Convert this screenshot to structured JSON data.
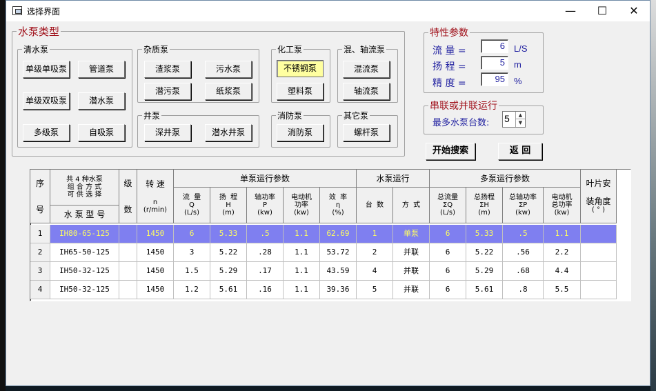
{
  "window": {
    "title": "选择界面",
    "minimize": "—",
    "maximize": "☐",
    "close": "✕"
  },
  "pump_types": {
    "legend": "水泵类型",
    "groups": {
      "clean": {
        "legend": "清水泵",
        "buttons": [
          "单级单吸泵",
          "管道泵",
          "单级双吸泵",
          "潜水泵",
          "多级泵",
          "自吸泵"
        ]
      },
      "impurity": {
        "legend": "杂质泵",
        "buttons": [
          "渣浆泵",
          "污水泵",
          "潜污泵",
          "纸浆泵"
        ]
      },
      "chemical": {
        "legend": "化工泵",
        "buttons": [
          "不锈钢泵",
          "塑料泵"
        ]
      },
      "mixed": {
        "legend": "混、轴流泵",
        "buttons": [
          "混流泵",
          "轴流泵"
        ]
      },
      "well": {
        "legend": "井泵",
        "buttons": [
          "深井泵",
          "潜水井泵"
        ]
      },
      "fire": {
        "legend": "消防泵",
        "buttons": [
          "消防泵"
        ]
      },
      "other": {
        "legend": "其它泵",
        "buttons": [
          "螺杆泵"
        ]
      }
    }
  },
  "params": {
    "legend": "特性参数",
    "flow": {
      "label": "流  量 =",
      "value": "6",
      "unit": "L/S"
    },
    "head": {
      "label": "扬  程 =",
      "value": "5",
      "unit": "m"
    },
    "accuracy": {
      "label": "精  度 =",
      "value": "95",
      "unit": "%"
    }
  },
  "series": {
    "legend": "串联或并联运行",
    "label": "最多水泵台数:",
    "value": "5"
  },
  "actions": {
    "search": "开始搜索",
    "back": "返  回"
  },
  "table": {
    "h_seq1": "序",
    "h_seq2": "号",
    "h_model_top": "共 4 种水泵\n组 合 方 式\n可 供 选 择",
    "h_model": "水 泵 型 号",
    "h_stage1": "级",
    "h_stage2": "数",
    "h_speed": "转  速",
    "h_speed_n": "n",
    "h_speed_unit": "(r/min)",
    "h_single": "单泵运行参数",
    "h_run": "水泵运行",
    "h_multi": "多泵运行参数",
    "h_blade1": "叶片安",
    "h_blade2": "装角度",
    "h_blade3": "( ° )",
    "single_cols": [
      "流  量\nQ\n(L/s)",
      "扬  程\nH\n(m)",
      "轴功率\nP\n(kw)",
      "电动机\n功率\n(kw)",
      "效  率\nη\n(%)"
    ],
    "run_cols": [
      "台  数",
      "方  式"
    ],
    "multi_cols": [
      "总流量\nΣQ\n(L/s)",
      "总扬程\nΣH\n(m)",
      "总轴功率\nΣP\n(kw)",
      "电动机\n总功率\n(kw)"
    ],
    "rows": [
      {
        "seq": "1",
        "model": "IH80-65-125",
        "stage": "",
        "speed": "1450",
        "q": "6",
        "h": "5.33",
        "p": ".5",
        "motor": "1.1",
        "eff": "62.69",
        "count": "1",
        "mode": "单泵",
        "sq": "6",
        "sh": "5.33",
        "sp": ".5",
        "smotor": "1.1",
        "blade": ""
      },
      {
        "seq": "2",
        "model": "IH65-50-125",
        "stage": "",
        "speed": "1450",
        "q": "3",
        "h": "5.22",
        "p": ".28",
        "motor": "1.1",
        "eff": "53.72",
        "count": "2",
        "mode": "并联",
        "sq": "6",
        "sh": "5.22",
        "sp": ".56",
        "smotor": "2.2",
        "blade": ""
      },
      {
        "seq": "3",
        "model": "IH50-32-125",
        "stage": "",
        "speed": "1450",
        "q": "1.5",
        "h": "5.29",
        "p": ".17",
        "motor": "1.1",
        "eff": "43.59",
        "count": "4",
        "mode": "并联",
        "sq": "6",
        "sh": "5.29",
        "sp": ".68",
        "smotor": "4.4",
        "blade": ""
      },
      {
        "seq": "4",
        "model": "IH50-32-125",
        "stage": "",
        "speed": "1450",
        "q": "1.2",
        "h": "5.61",
        "p": ".16",
        "motor": "1.1",
        "eff": "39.36",
        "count": "5",
        "mode": "并联",
        "sq": "6",
        "sh": "5.61",
        "sp": ".8",
        "smotor": "5.5",
        "blade": ""
      }
    ],
    "selected_row": 0
  }
}
